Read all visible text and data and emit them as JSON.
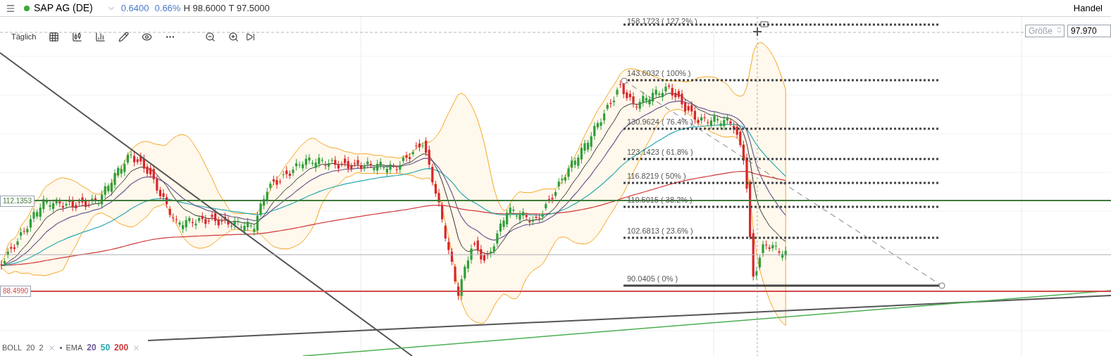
{
  "header": {
    "online": true,
    "symbol": "SAP AG (DE)",
    "change": "0.6400",
    "change_percent": "0.66%",
    "high": "H 98.6000",
    "low": "T 97.5000",
    "trade_label": "Handel"
  },
  "toolbar": {
    "period": "Täglich"
  },
  "order": {
    "size_placeholder": "Größe",
    "price": "97.970"
  },
  "price_labels": [
    {
      "text": "112.1353",
      "color": "#3f7a3a"
    },
    {
      "text": "88.4990",
      "color": "#d24b4b"
    }
  ],
  "fibonacci": [
    {
      "label": "158.1723 ( 127.2% )"
    },
    {
      "label": "143.6032 ( 100% )"
    },
    {
      "label": "130.9624 ( 76.4% )"
    },
    {
      "label": "123.1423 ( 61.8% )"
    },
    {
      "label": "116.8219 ( 50% )"
    },
    {
      "label": "110.5015 ( 38.2% )"
    },
    {
      "label": "102.6813 ( 23.6% )"
    },
    {
      "label": "90.0405 ( 0% )"
    }
  ],
  "legend": {
    "boll": {
      "name": "BOLL",
      "params": [
        "20",
        "2"
      ]
    },
    "ema": {
      "name": "EMA",
      "periods": [
        {
          "text": "20",
          "color": "#6b5b95"
        },
        {
          "text": "50",
          "color": "#2aa8b0"
        },
        {
          "text": "200",
          "color": "#d03a3a"
        }
      ]
    }
  }
}
